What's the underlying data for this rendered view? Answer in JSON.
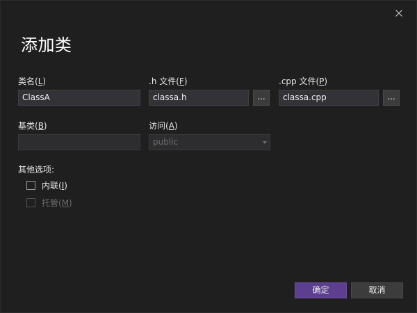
{
  "dialog": {
    "title": "添加类",
    "close_icon": "close-icon"
  },
  "class_name": {
    "label_text": "类名(",
    "label_key": "L",
    "label_end": ")",
    "value": "ClassA"
  },
  "h_file": {
    "label_text": ".h 文件(",
    "label_key": "F",
    "label_end": ")",
    "value": "classa.h",
    "browse_label": "..."
  },
  "cpp_file": {
    "label_text": ".cpp 文件(",
    "label_key": "P",
    "label_end": ")",
    "value": "classa.cpp",
    "browse_label": "..."
  },
  "base_class": {
    "label_text": "基类(",
    "label_key": "B",
    "label_end": ")",
    "value": ""
  },
  "access": {
    "label_text": "访问(",
    "label_key": "A",
    "label_end": ")",
    "selected": "public"
  },
  "other_options": {
    "label": "其他选项:",
    "inline": {
      "label_text": "内联(",
      "label_key": "I",
      "label_end": ")",
      "checked": false
    },
    "managed": {
      "label_text": "托管(",
      "label_key": "M",
      "label_end": ")",
      "checked": false,
      "disabled": true
    }
  },
  "buttons": {
    "ok": "确定",
    "cancel": "取消"
  },
  "colors": {
    "background": "#1f1f1f",
    "primary_button": "#5d3f8f",
    "input_background": "#333337"
  }
}
